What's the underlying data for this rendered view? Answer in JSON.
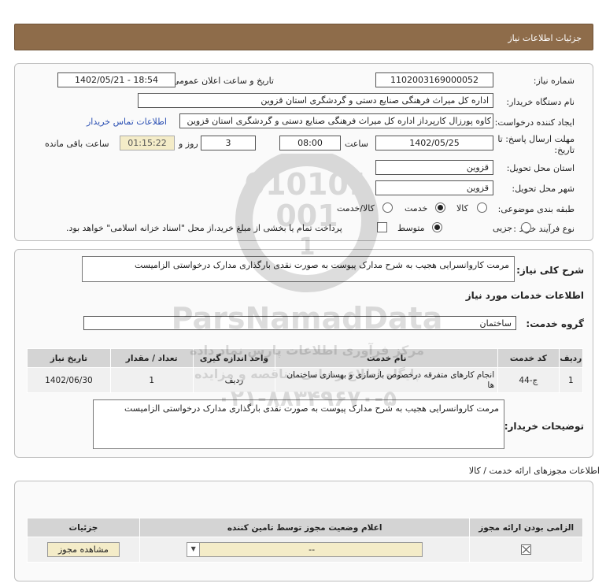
{
  "header": {
    "title": "جزئیات اطلاعات نیاز"
  },
  "form": {
    "need_no_label": "شماره نیاز:",
    "need_no_value": "1102003169000052",
    "announce_label": "تاریخ و ساعت اعلان عمومی:",
    "announce_value": "1402/05/21 - 18:54",
    "buyer_org_label": "نام دستگاه خریدار:",
    "buyer_org_value": "اداره کل میراث فرهنگی  صنایع دستی و گردشگری استان قزوین",
    "creator_label": "ایجاد کننده درخواست:",
    "creator_value": "کاوه پورزال کارپرداز اداره کل میراث فرهنگی  صنایع دستی و گردشگری استان قزوین",
    "contact_link": "اطلاعات تماس خریدار",
    "deadline_label_1": "مهلت ارسال پاسخ: تا",
    "deadline_label_2": "تاریخ:",
    "deadline_date": "1402/05/25",
    "time_label": "ساعت",
    "deadline_time": "08:00",
    "days_value": "3",
    "days_label": "روز و",
    "remaining_time": "01:15:22",
    "remaining_label": "ساعت باقی مانده",
    "province_label": "استان محل تحویل:",
    "province_value": "قزوین",
    "city_label": "شهر محل تحویل:",
    "city_value": "قزوین",
    "category_label": "طبقه بندی موضوعی:",
    "category_options": [
      "کالا",
      "خدمت",
      "کالا/خدمت"
    ],
    "category_selected": "خدمت",
    "process_label": "نوع فرآیند خرید :",
    "process_options": [
      "جزیی",
      "متوسط"
    ],
    "process_selected": "متوسط",
    "payment_note": "پرداخت تمام یا بخشی از مبلغ خرید،از محل \"اسناد خزانه اسلامی\" خواهد بود."
  },
  "summary": {
    "label": "شرح کلی نیاز:",
    "text": "مرمت کاروانسرایی هجیب به شرح مدارک پیوست به صورت نقدی بارگذاری مدارک درخواستی الزامیست"
  },
  "services": {
    "section_title": "اطلاعات خدمات مورد نیاز",
    "group_label": "گروه خدمت:",
    "group_value": "ساختمان",
    "table": {
      "headers": [
        "ردیف",
        "کد خدمت",
        "نام خدمت",
        "واحد اندازه گیری",
        "تعداد / مقدار",
        "تاریخ نیاز"
      ],
      "rows": [
        [
          "1",
          "ج-44",
          "انجام کارهای متفرقه درخصوص بازسازی و بهسازی ساختمان ها",
          "ردیف",
          "1",
          "1402/06/30"
        ]
      ]
    },
    "buyer_notes_label": "توضیحات خریدار:",
    "buyer_notes_text": "مرمت کاروانسرایی هجیب به شرح مدارک پیوست به صورت نقدی بارگذاری مدارک درخواستی الزامیست"
  },
  "permits": {
    "section_title": "اطلاعات مجوزهای ارائه خدمت / کالا",
    "headers": [
      "الزامی بودن ارائه مجوز",
      "اعلام وضعیت مجوز توسط تامین کننده",
      "جزئیات"
    ],
    "status_value": "--",
    "view_button": "مشاهده مجوز"
  },
  "watermark": {
    "brand": "ParsNamadData",
    "tagline": "مرکز فرآوری اطلاعات پارس نماد داده",
    "sub": "پایگاه اطلاع رسانی مناقصه و مزایده",
    "phone": "۰۲۱-۸۸۳۴۹۶۷۰-۵"
  },
  "colors": {
    "header_bg": "#8e6c4a",
    "highlight_bg": "#f4ecc8",
    "link": "#2a4fb3"
  }
}
